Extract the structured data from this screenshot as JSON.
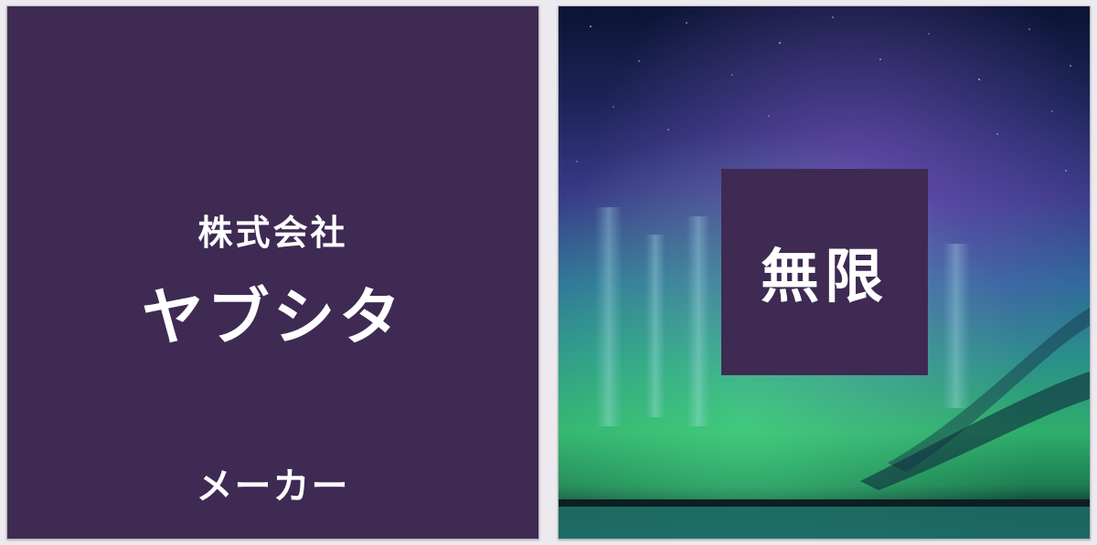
{
  "left_panel": {
    "company_type": "株式会社",
    "company_name": "ヤブシタ",
    "company_role": "メーカー"
  },
  "right_panel": {
    "brand_name": "無限"
  },
  "colors": {
    "brand_purple": "#3e2a52",
    "text": "#ffffff",
    "sky_top": "#0a1030",
    "aurora_violet": "#6a4ab0",
    "aurora_green": "#2ec070"
  }
}
